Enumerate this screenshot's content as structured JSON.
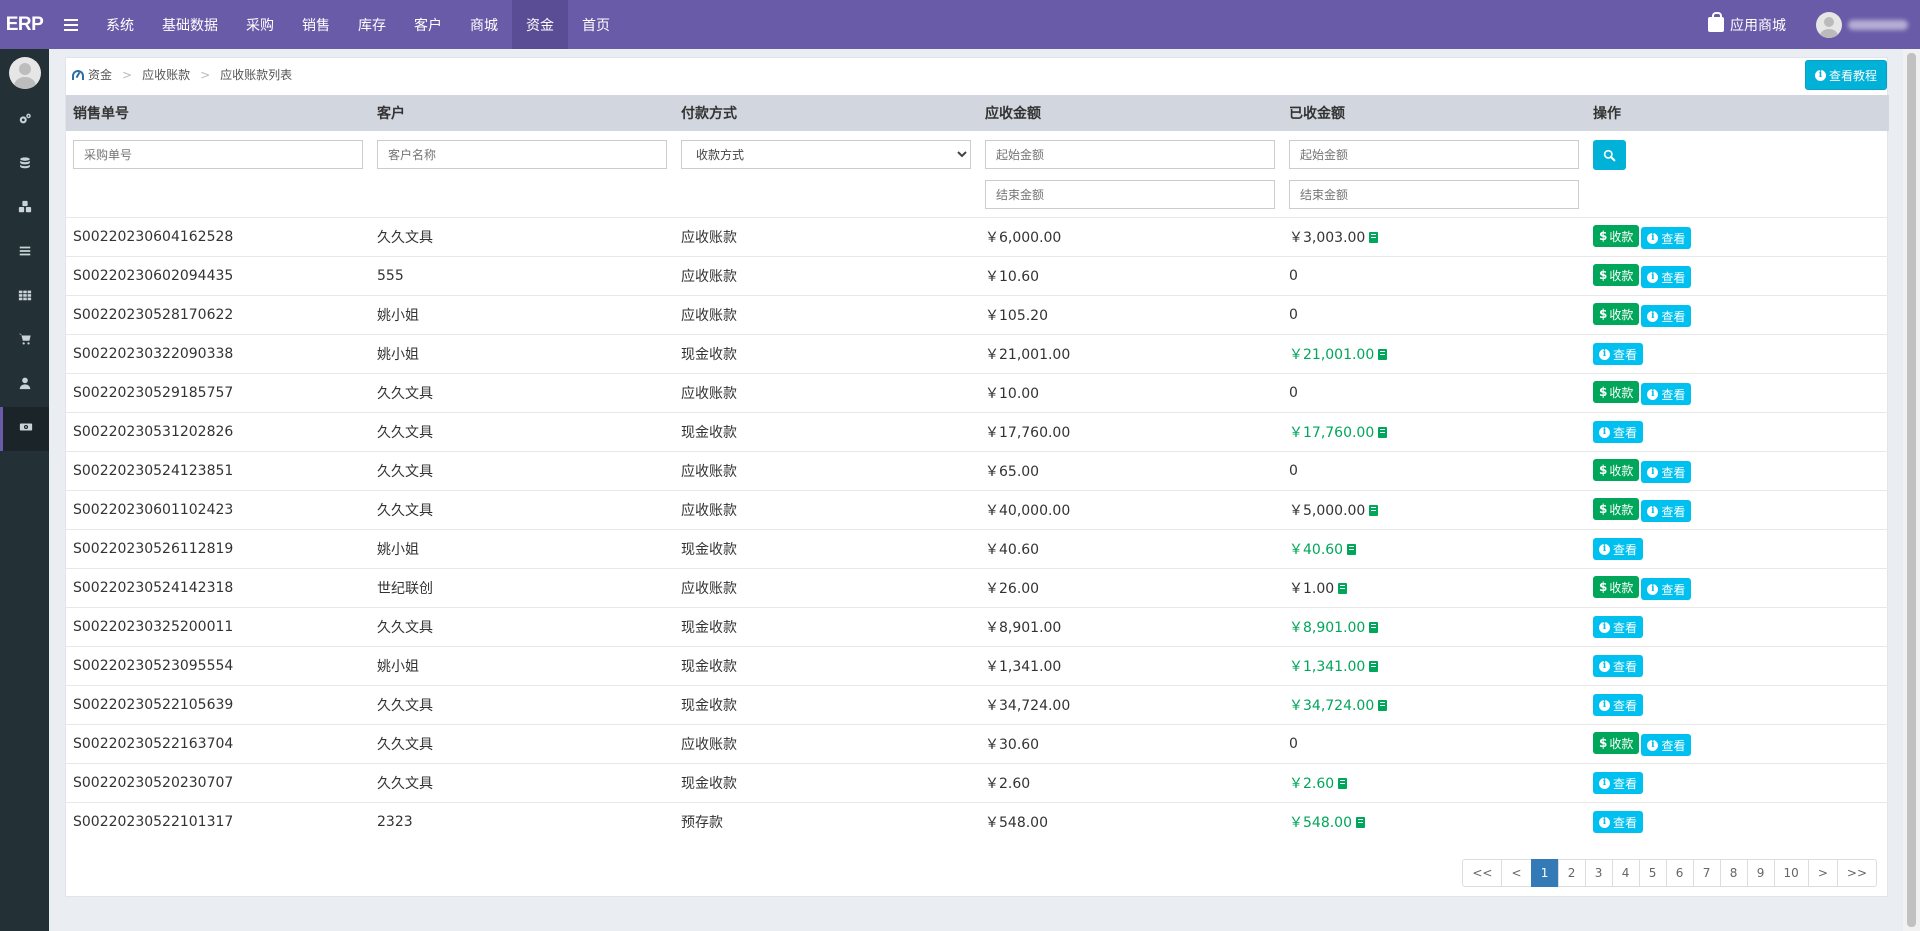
{
  "app": {
    "logo": "ERP"
  },
  "nav": {
    "items": [
      {
        "label": "系统",
        "active": false
      },
      {
        "label": "基础数据",
        "active": false
      },
      {
        "label": "采购",
        "active": false
      },
      {
        "label": "销售",
        "active": false
      },
      {
        "label": "库存",
        "active": false
      },
      {
        "label": "客户",
        "active": false
      },
      {
        "label": "商城",
        "active": false
      },
      {
        "label": "资金",
        "active": true
      },
      {
        "label": "首页",
        "active": false
      }
    ],
    "app_store": "应用商城"
  },
  "sidebar": {
    "icons": [
      "gears-icon",
      "database-icon",
      "cubes-icon",
      "list-icon",
      "grid-icon",
      "cart-icon",
      "user-icon",
      "money-icon"
    ],
    "active_index": 7
  },
  "breadcrumb": [
    "资金",
    "应收账款",
    "应收账款列表"
  ],
  "tutorial_button": "查看教程",
  "table": {
    "headers": [
      "销售单号",
      "客户",
      "付款方式",
      "应收金额",
      "已收金额",
      "操作"
    ],
    "filters": {
      "order_placeholder": "采购单号",
      "customer_placeholder": "客户名称",
      "payment_select": "收款方式",
      "recv_start_placeholder": "起始金额",
      "recv_end_placeholder": "结束金额",
      "paid_start_placeholder": "起始金额",
      "paid_end_placeholder": "结束金额"
    },
    "collect_label": "收款",
    "view_label": "查看",
    "rows": [
      {
        "order": "S00220230604162528",
        "customer": "久久文具",
        "method": "应收账款",
        "receivable": "￥6,000.00",
        "received": "￥3,003.00",
        "status": "partial"
      },
      {
        "order": "S00220230602094435",
        "customer": "555",
        "method": "应收账款",
        "receivable": "￥10.60",
        "received": "0",
        "status": "none"
      },
      {
        "order": "S00220230528170622",
        "customer": "姚小姐",
        "method": "应收账款",
        "receivable": "￥105.20",
        "received": "0",
        "status": "none"
      },
      {
        "order": "S00220230322090338",
        "customer": "姚小姐",
        "method": "现金收款",
        "receivable": "￥21,001.00",
        "received": "￥21,001.00",
        "status": "full"
      },
      {
        "order": "S00220230529185757",
        "customer": "久久文具",
        "method": "应收账款",
        "receivable": "￥10.00",
        "received": "0",
        "status": "none"
      },
      {
        "order": "S00220230531202826",
        "customer": "久久文具",
        "method": "现金收款",
        "receivable": "￥17,760.00",
        "received": "￥17,760.00",
        "status": "full"
      },
      {
        "order": "S00220230524123851",
        "customer": "久久文具",
        "method": "应收账款",
        "receivable": "￥65.00",
        "received": "0",
        "status": "none"
      },
      {
        "order": "S00220230601102423",
        "customer": "久久文具",
        "method": "应收账款",
        "receivable": "￥40,000.00",
        "received": "￥5,000.00",
        "status": "partial"
      },
      {
        "order": "S00220230526112819",
        "customer": "姚小姐",
        "method": "现金收款",
        "receivable": "￥40.60",
        "received": "￥40.60",
        "status": "full"
      },
      {
        "order": "S00220230524142318",
        "customer": "世纪联创",
        "method": "应收账款",
        "receivable": "￥26.00",
        "received": "￥1.00",
        "status": "partial"
      },
      {
        "order": "S00220230325200011",
        "customer": "久久文具",
        "method": "现金收款",
        "receivable": "￥8,901.00",
        "received": "￥8,901.00",
        "status": "full"
      },
      {
        "order": "S00220230523095554",
        "customer": "姚小姐",
        "method": "现金收款",
        "receivable": "￥1,341.00",
        "received": "￥1,341.00",
        "status": "full"
      },
      {
        "order": "S00220230522105639",
        "customer": "久久文具",
        "method": "现金收款",
        "receivable": "￥34,724.00",
        "received": "￥34,724.00",
        "status": "full"
      },
      {
        "order": "S00220230522163704",
        "customer": "久久文具",
        "method": "应收账款",
        "receivable": "￥30.60",
        "received": "0",
        "status": "none"
      },
      {
        "order": "S00220230520230707",
        "customer": "久久文具",
        "method": "现金收款",
        "receivable": "￥2.60",
        "received": "￥2.60",
        "status": "full"
      },
      {
        "order": "S00220230522101317",
        "customer": "2323",
        "method": "预存款",
        "receivable": "￥548.00",
        "received": "￥548.00",
        "status": "full"
      }
    ]
  },
  "pagination": {
    "pages": [
      "<<",
      "<",
      "1",
      "2",
      "3",
      "4",
      "5",
      "6",
      "7",
      "8",
      "9",
      "10",
      ">",
      ">>"
    ],
    "current": "1"
  },
  "colors": {
    "topbar": "#6a5ba8",
    "sidebar": "#233036",
    "collect_button": "#00a65a",
    "view_button": "#00c0ef",
    "partial_icon": "#00a65a",
    "paid_text": "#00a65a"
  }
}
